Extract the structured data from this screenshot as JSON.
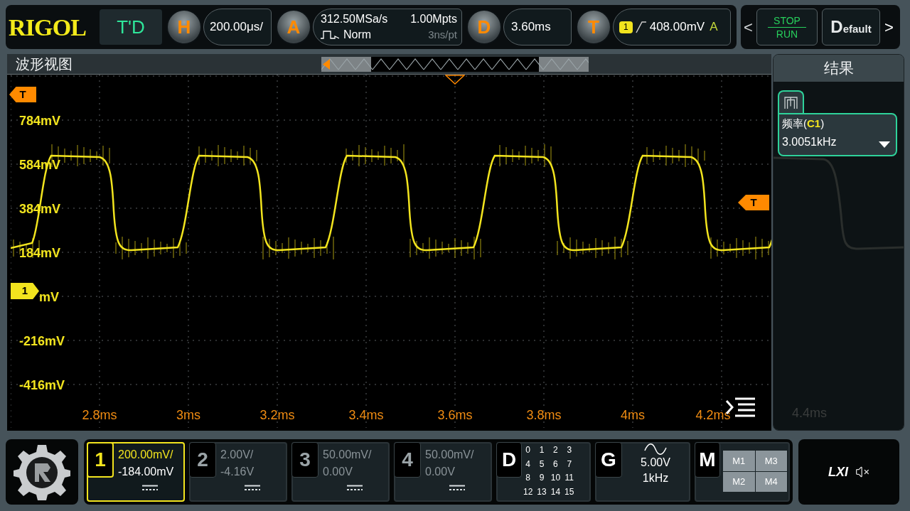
{
  "header": {
    "logo": "RIGOL",
    "mode": "T'D",
    "horizontal": {
      "badge": "H",
      "value": "200.00μs/"
    },
    "acquire": {
      "badge": "A",
      "sample_rate": "312.50MSa/s",
      "memory": "1.00Mpts",
      "mode": "Norm",
      "resolution": "3ns/pt"
    },
    "delay": {
      "badge": "D",
      "value": "3.60ms"
    },
    "trigger": {
      "badge": "T",
      "source": "1",
      "level": "408.00mV",
      "sweep": "A"
    },
    "run_control": {
      "prev": "<",
      "stop": "STOP",
      "run": "RUN",
      "default": "Default",
      "next": ">"
    }
  },
  "waveform_view": {
    "title": "波形视图",
    "left_trigger_marker": "T",
    "right_trigger_marker": "T",
    "channel_marker": "1",
    "y_labels": [
      "784mV",
      "584mV",
      "384mV",
      "184mV",
      "mV",
      "-216mV",
      "-416mV"
    ],
    "x_labels": [
      "2.8ms",
      "3ms",
      "3.2ms",
      "3.4ms",
      "3.6ms",
      "3.8ms",
      "4ms",
      "4.2ms"
    ]
  },
  "results": {
    "title": "结果",
    "measurement": {
      "label": "频率(**C1**)",
      "value": "3.0051kHz"
    },
    "hidden_x_label": "4.4ms"
  },
  "channels": [
    {
      "number": "1",
      "scale": "200.00mV/",
      "offset": "-184.00mV",
      "selected": true
    },
    {
      "number": "2",
      "scale": "2.00V/",
      "offset": "-4.16V",
      "selected": false
    },
    {
      "number": "3",
      "scale": "50.00mV/",
      "offset": "0.00V",
      "selected": false
    },
    {
      "number": "4",
      "scale": "50.00mV/",
      "offset": "0.00V",
      "selected": false
    }
  ],
  "digital": {
    "badge": "D",
    "bits": [
      "0",
      "1",
      "2",
      "3",
      "4",
      "5",
      "6",
      "7",
      "8",
      "9",
      "10",
      "11",
      "12",
      "13",
      "14",
      "15"
    ]
  },
  "generator": {
    "badge": "G",
    "amplitude": "5.00V",
    "frequency": "1kHz"
  },
  "math": {
    "badge": "M",
    "slots": [
      "M1",
      "M3",
      "M2",
      "M4"
    ]
  },
  "status": {
    "lxi": "LXI"
  }
}
